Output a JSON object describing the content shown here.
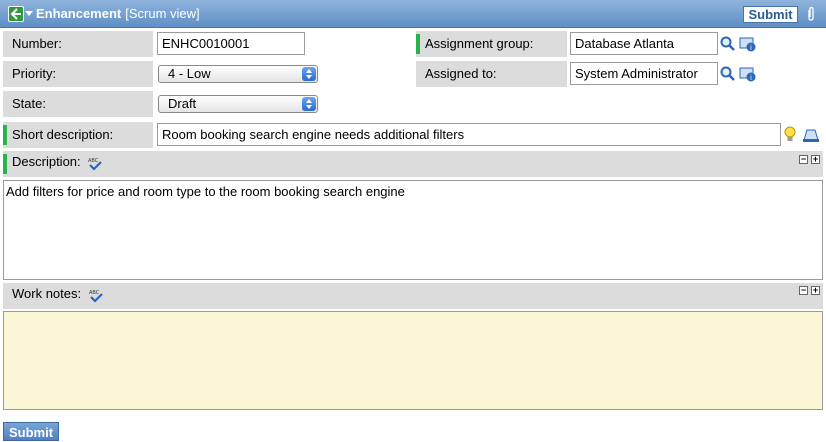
{
  "header": {
    "title": "Enhancement",
    "view": "[Scrum view]",
    "submit_label": "Submit"
  },
  "fields": {
    "number": {
      "label": "Number:",
      "value": "ENHC0010001"
    },
    "priority": {
      "label": "Priority:",
      "value": "4 - Low"
    },
    "state": {
      "label": "State:",
      "value": "Draft"
    },
    "assignment_group": {
      "label": "Assignment group:",
      "value": "Database Atlanta"
    },
    "assigned_to": {
      "label": "Assigned to:",
      "value": "System Administrator"
    },
    "short_description": {
      "label": "Short description:",
      "value": "Room booking search engine needs additional filters"
    }
  },
  "description": {
    "label": "Description:",
    "value": "Add filters for price and room type to the room booking search engine"
  },
  "work_notes": {
    "label": "Work notes:",
    "value": ""
  },
  "footer": {
    "submit_label": "Submit"
  },
  "colors": {
    "header": "#5f8fc6",
    "mandatory": "#2ab24b",
    "label_bg": "#dcdcdc",
    "work_notes_bg": "#fbf6d6"
  }
}
